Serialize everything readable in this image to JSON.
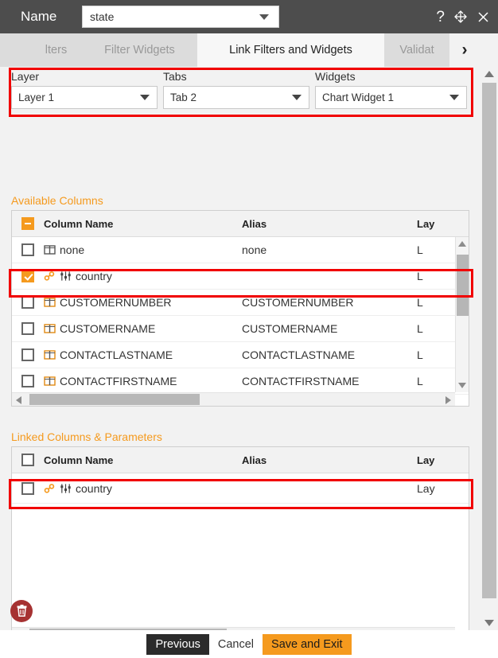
{
  "window": {
    "name_label": "Name",
    "name_value": "state",
    "help_icon": "question-mark-icon",
    "move_icon": "move-arrows-icon",
    "close_icon": "close-icon"
  },
  "tabs": {
    "prev_arrow": "‹",
    "next_arrow": "›",
    "items": [
      {
        "label": "lters",
        "active": false
      },
      {
        "label": "Filter Widgets",
        "active": false
      },
      {
        "label": "Link Filters and Widgets",
        "active": true
      },
      {
        "label": "Validat",
        "active": false
      }
    ]
  },
  "selectors": [
    {
      "label": "Layer",
      "value": "Layer 1"
    },
    {
      "label": "Tabs",
      "value": "Tab 2"
    },
    {
      "label": "Widgets",
      "value": "Chart Widget 1"
    }
  ],
  "available": {
    "title": "Available Columns",
    "headers": {
      "check": "indeterminate",
      "name": "Column Name",
      "alias": "Alias",
      "layer": "Lay"
    },
    "rows": [
      {
        "checked": false,
        "icon": "column-icon",
        "name": "none",
        "alias": "none",
        "layer": "L"
      },
      {
        "checked": true,
        "icon": "link-filter-icon",
        "name": "country",
        "alias": "",
        "layer": "L"
      },
      {
        "checked": false,
        "icon": "column-icon",
        "name": "CUSTOMERNUMBER",
        "alias": "CUSTOMERNUMBER",
        "layer": "L"
      },
      {
        "checked": false,
        "icon": "column-icon",
        "name": "CUSTOMERNAME",
        "alias": "CUSTOMERNAME",
        "layer": "L"
      },
      {
        "checked": false,
        "icon": "column-icon",
        "name": "CONTACTLASTNAME",
        "alias": "CONTACTLASTNAME",
        "layer": "L"
      },
      {
        "checked": false,
        "icon": "column-icon",
        "name": "CONTACTFIRSTNAME",
        "alias": "CONTACTFIRSTNAME",
        "layer": "L"
      }
    ]
  },
  "linked": {
    "title": "Linked Columns & Parameters",
    "headers": {
      "check": "unchecked",
      "name": "Column Name",
      "alias": "Alias",
      "layer": "Lay"
    },
    "rows": [
      {
        "checked": false,
        "icon": "link-filter-icon",
        "name": "country",
        "alias": "",
        "layer": "Lay"
      }
    ]
  },
  "delete_button": {
    "icon": "trash-icon"
  },
  "footer": {
    "previous_label": "Previous",
    "cancel_label": "Cancel",
    "save_label": "Save and Exit"
  },
  "colors": {
    "accent_orange": "#f59a1e",
    "highlight_red": "#f10000",
    "titlebar": "#4d4d4d",
    "delete_red": "#a63232"
  }
}
